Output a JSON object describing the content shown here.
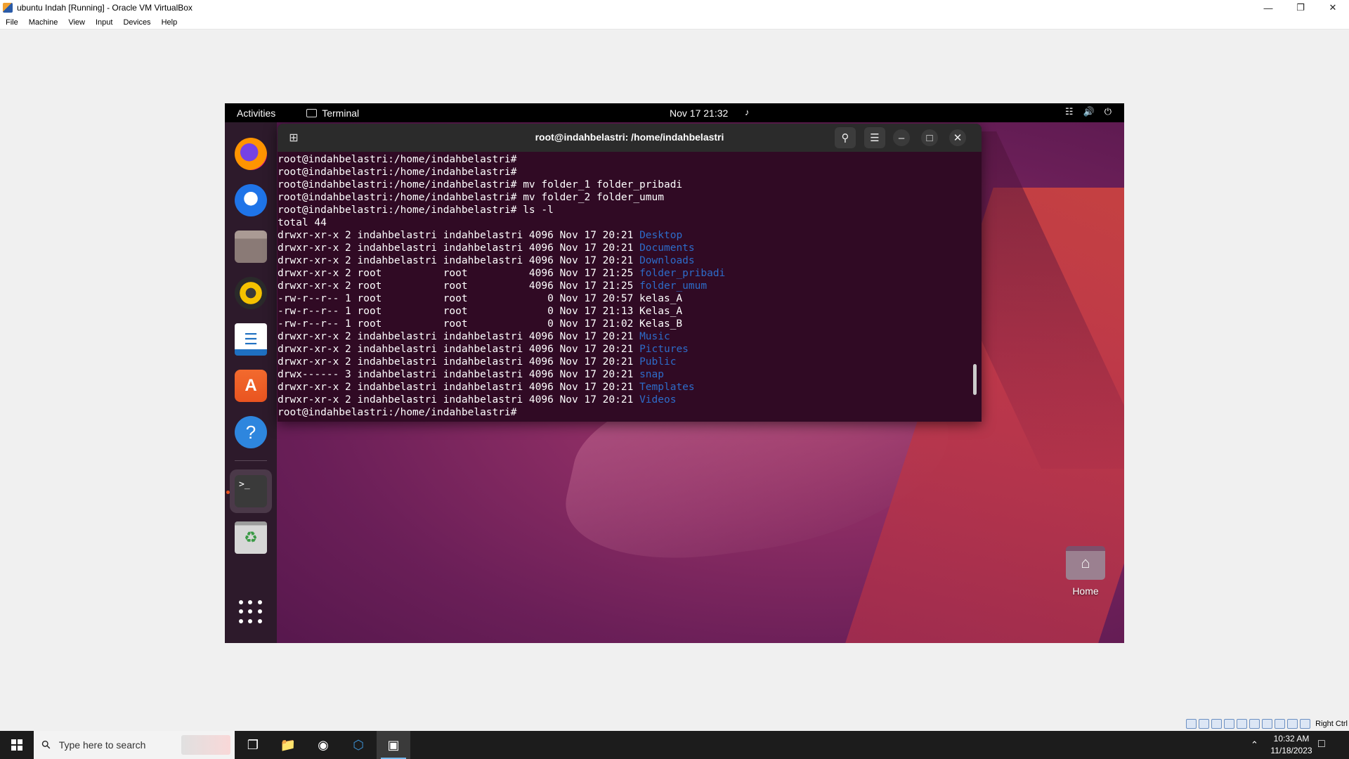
{
  "host": {
    "title": "ubuntu Indah [Running] - Oracle VM VirtualBox",
    "menu": [
      "File",
      "Machine",
      "View",
      "Input",
      "Devices",
      "Help"
    ],
    "status_right": "Right Ctrl"
  },
  "guest": {
    "topbar": {
      "activities": "Activities",
      "app_name": "Terminal",
      "clock": "Nov 17  21:32"
    },
    "dock_items": [
      "firefox",
      "thunderbird",
      "files",
      "rhythmbox",
      "libreoffice-writer",
      "app-center",
      "help",
      "terminal",
      "trash"
    ],
    "desktop": {
      "home_label": "Home"
    },
    "terminal": {
      "title": "root@indahbelastri: /home/indahbelastri",
      "lines": [
        {
          "text": "root@indahbelastri:/home/indahbelastri#",
          "dir": ""
        },
        {
          "text": "root@indahbelastri:/home/indahbelastri#",
          "dir": ""
        },
        {
          "text": "root@indahbelastri:/home/indahbelastri# mv folder_1 folder_pribadi",
          "dir": ""
        },
        {
          "text": "root@indahbelastri:/home/indahbelastri# mv folder_2 folder_umum",
          "dir": ""
        },
        {
          "text": "root@indahbelastri:/home/indahbelastri# ls -l",
          "dir": ""
        },
        {
          "text": "total 44",
          "dir": ""
        },
        {
          "text": "drwxr-xr-x 2 indahbelastri indahbelastri 4096 Nov 17 20:21 ",
          "dir": "Desktop"
        },
        {
          "text": "drwxr-xr-x 2 indahbelastri indahbelastri 4096 Nov 17 20:21 ",
          "dir": "Documents"
        },
        {
          "text": "drwxr-xr-x 2 indahbelastri indahbelastri 4096 Nov 17 20:21 ",
          "dir": "Downloads"
        },
        {
          "text": "drwxr-xr-x 2 root          root          4096 Nov 17 21:25 ",
          "dir": "folder_pribadi"
        },
        {
          "text": "drwxr-xr-x 2 root          root          4096 Nov 17 21:25 ",
          "dir": "folder_umum"
        },
        {
          "text": "-rw-r--r-- 1 root          root             0 Nov 17 20:57 kelas_A",
          "dir": ""
        },
        {
          "text": "-rw-r--r-- 1 root          root             0 Nov 17 21:13 Kelas_A",
          "dir": ""
        },
        {
          "text": "-rw-r--r-- 1 root          root             0 Nov 17 21:02 Kelas_B",
          "dir": ""
        },
        {
          "text": "drwxr-xr-x 2 indahbelastri indahbelastri 4096 Nov 17 20:21 ",
          "dir": "Music"
        },
        {
          "text": "drwxr-xr-x 2 indahbelastri indahbelastri 4096 Nov 17 20:21 ",
          "dir": "Pictures"
        },
        {
          "text": "drwxr-xr-x 2 indahbelastri indahbelastri 4096 Nov 17 20:21 ",
          "dir": "Public"
        },
        {
          "text": "drwx------ 3 indahbelastri indahbelastri 4096 Nov 17 20:21 ",
          "dir": "snap"
        },
        {
          "text": "drwxr-xr-x 2 indahbelastri indahbelastri 4096 Nov 17 20:21 ",
          "dir": "Templates"
        },
        {
          "text": "drwxr-xr-x 2 indahbelastri indahbelastri 4096 Nov 17 20:21 ",
          "dir": "Videos"
        },
        {
          "text": "root@indahbelastri:/home/indahbelastri#",
          "dir": ""
        }
      ]
    }
  },
  "taskbar": {
    "search_placeholder": "Type here to search",
    "time": "10:32 AM",
    "date": "11/18/2023"
  },
  "colors": {
    "terminal_bg": "#300a24",
    "dir_color": "#2d6cc9",
    "ubuntu_orange": "#e95420"
  }
}
